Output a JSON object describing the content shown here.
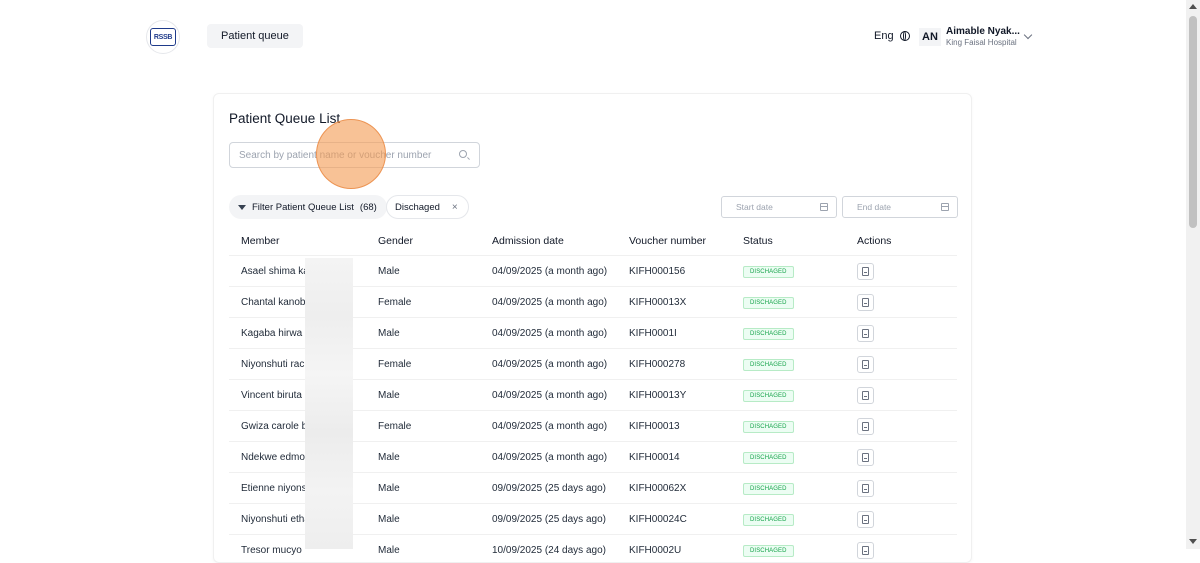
{
  "header": {
    "logo_text": "RSSB",
    "nav_label": "Patient queue",
    "language": "Eng",
    "user_initials": "AN",
    "user_name": "Aimable Nyak...",
    "user_org": "King Faisal Hospital"
  },
  "main": {
    "title": "Patient Queue List",
    "search_placeholder": "Search by patient name or voucher number",
    "filter_label": "Filter Patient Queue List",
    "filter_count": "(68)",
    "active_filter": "Dischaged",
    "start_date_placeholder": "Start date",
    "end_date_placeholder": "End date",
    "columns": [
      "Member",
      "Gender",
      "Admission date",
      "Voucher number",
      "Status",
      "Actions"
    ],
    "rows": [
      {
        "member": "Asael shima kag",
        "gender": "Male",
        "admission": "04/09/2025 (a month ago)",
        "voucher": "KIFH000156",
        "status": "DISCHAGED"
      },
      {
        "member": "Chantal kanoba",
        "gender": "Female",
        "admission": "04/09/2025 (a month ago)",
        "voucher": "KIFH00013X",
        "status": "DISCHAGED"
      },
      {
        "member": "Kagaba hirwa",
        "gender": "Male",
        "admission": "04/09/2025 (a month ago)",
        "voucher": "KIFH0001I",
        "status": "DISCHAGED"
      },
      {
        "member": "Niyonshuti rach",
        "gender": "Female",
        "admission": "04/09/2025 (a month ago)",
        "voucher": "KIFH000278",
        "status": "DISCHAGED"
      },
      {
        "member": "Vincent biruta",
        "gender": "Male",
        "admission": "04/09/2025 (a month ago)",
        "voucher": "KIFH00013Y",
        "status": "DISCHAGED"
      },
      {
        "member": "Gwiza carole bi",
        "gender": "Female",
        "admission": "04/09/2025 (a month ago)",
        "voucher": "KIFH00013",
        "status": "DISCHAGED"
      },
      {
        "member": "Ndekwe edmor",
        "gender": "Male",
        "admission": "04/09/2025 (a month ago)",
        "voucher": "KIFH00014",
        "status": "DISCHAGED"
      },
      {
        "member": "Etienne niyonsh",
        "gender": "Male",
        "admission": "09/09/2025 (25 days ago)",
        "voucher": "KIFH00062X",
        "status": "DISCHAGED"
      },
      {
        "member": "Niyonshuti etha",
        "gender": "Male",
        "admission": "09/09/2025 (25 days ago)",
        "voucher": "KIFH00024C",
        "status": "DISCHAGED"
      },
      {
        "member": "Tresor mucyo",
        "gender": "Male",
        "admission": "10/09/2025 (24 days ago)",
        "voucher": "KIFH0002U",
        "status": "DISCHAGED"
      }
    ]
  }
}
